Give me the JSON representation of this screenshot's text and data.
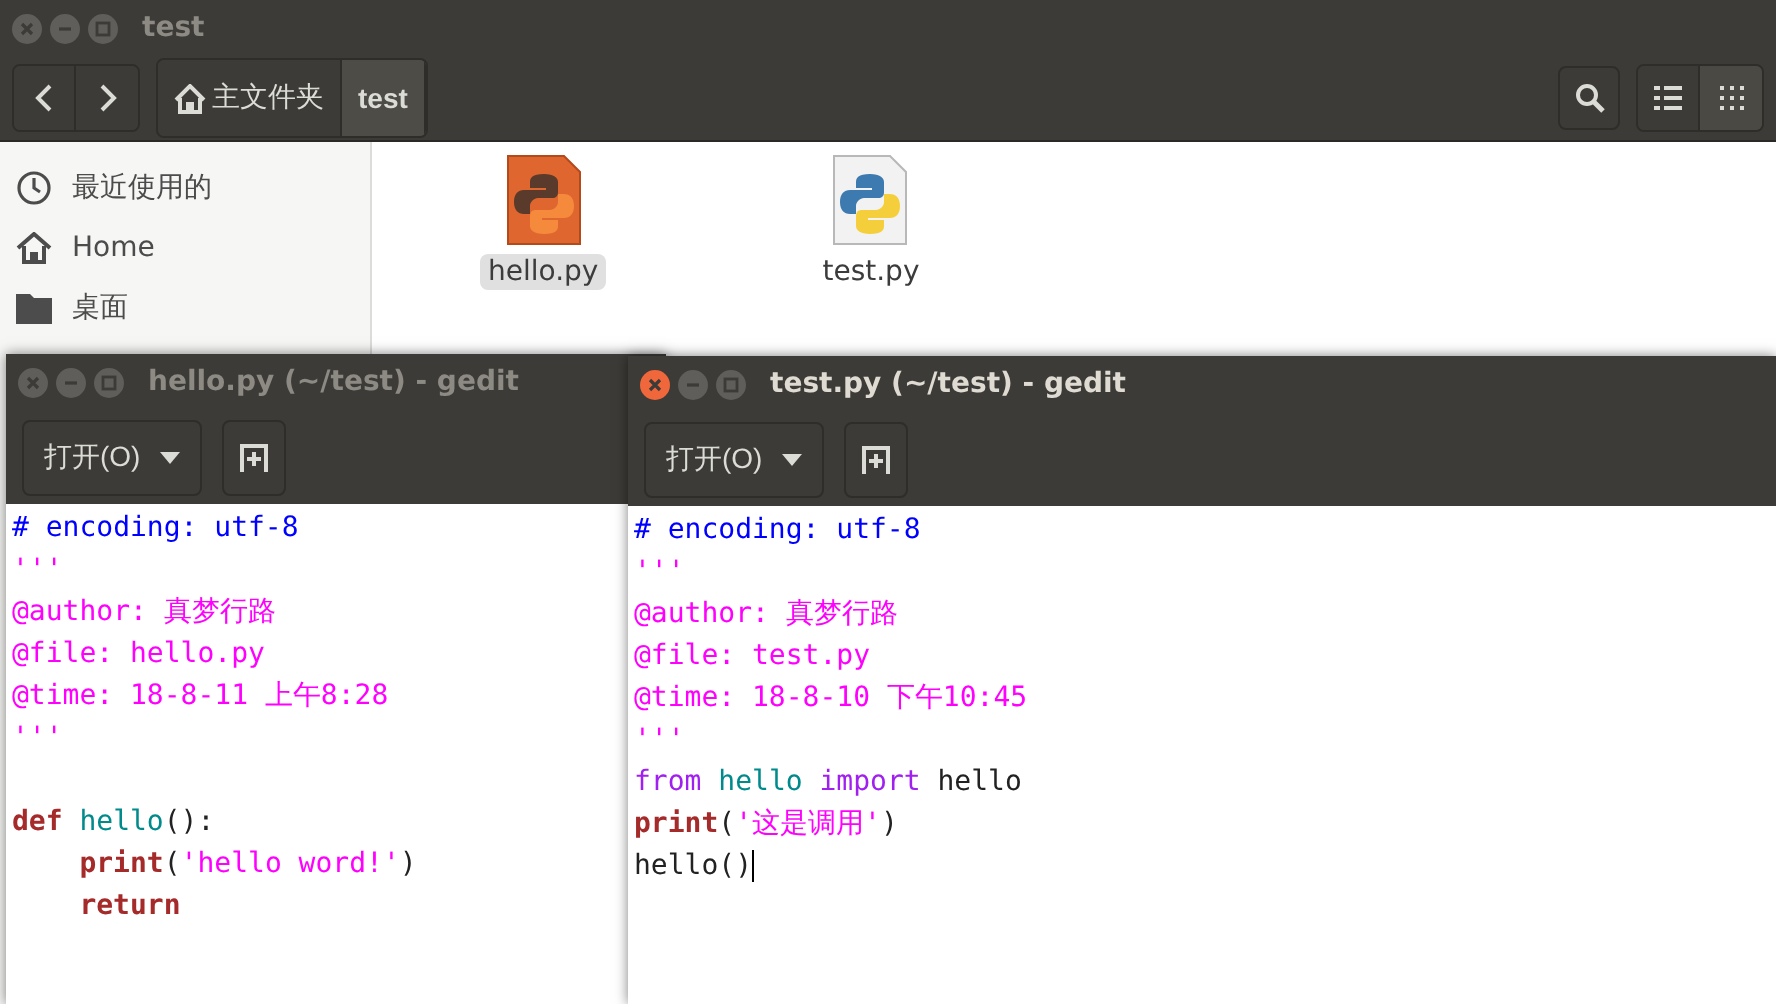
{
  "file_manager": {
    "title": "test",
    "path": [
      {
        "label": "主文件夹",
        "kind": "home",
        "selected": false
      },
      {
        "label": "test",
        "kind": "folder",
        "selected": true
      }
    ],
    "view_modes": [
      {
        "kind": "list",
        "selected": false
      },
      {
        "kind": "grid",
        "selected": true
      }
    ],
    "sidebar": [
      {
        "label": "最近使用的",
        "kind": "clock"
      },
      {
        "label": "Home",
        "kind": "home"
      },
      {
        "label": "桌面",
        "kind": "folder"
      }
    ],
    "files": [
      {
        "name": "hello.py",
        "kind": "orange",
        "selected": true
      },
      {
        "name": "test.py",
        "kind": "plain",
        "selected": false
      }
    ]
  },
  "editors": [
    {
      "title": "hello.py (~/test) - gedit",
      "active": false,
      "open_button": "打开(O)",
      "lines": [
        {
          "tokens": [
            {
              "kind": "comment",
              "text": "# encoding: utf-8"
            }
          ]
        },
        {
          "tokens": [
            {
              "kind": "string",
              "text": "'''"
            }
          ]
        },
        {
          "tokens": [
            {
              "kind": "string",
              "text": "@author: 真梦行路"
            }
          ]
        },
        {
          "tokens": [
            {
              "kind": "string",
              "text": "@file: hello.py"
            }
          ]
        },
        {
          "tokens": [
            {
              "kind": "string",
              "text": "@time: 18-8-11 上午8:28"
            }
          ]
        },
        {
          "tokens": [
            {
              "kind": "string",
              "text": "'''"
            }
          ]
        },
        {
          "gap_before": true,
          "tokens": [
            {
              "kind": "keyword",
              "text": "def "
            },
            {
              "kind": "name",
              "text": "hello"
            },
            {
              "kind": "plain",
              "text": "():"
            }
          ]
        },
        {
          "indented": true,
          "tokens": [
            {
              "kind": "keyword",
              "text": "print"
            },
            {
              "kind": "plain",
              "text": "("
            },
            {
              "kind": "string",
              "text": "'hello word!'"
            },
            {
              "kind": "plain",
              "text": ")"
            }
          ]
        },
        {
          "indented": true,
          "tokens": [
            {
              "kind": "keyword",
              "text": "return"
            }
          ]
        }
      ]
    },
    {
      "title": "test.py (~/test) - gedit",
      "active": true,
      "open_button": "打开(O)",
      "lines": [
        {
          "tokens": [
            {
              "kind": "comment",
              "text": "# encoding: utf-8"
            }
          ]
        },
        {
          "tokens": [
            {
              "kind": "string",
              "text": "'''"
            }
          ]
        },
        {
          "tokens": [
            {
              "kind": "string",
              "text": "@author: 真梦行路"
            }
          ]
        },
        {
          "tokens": [
            {
              "kind": "string",
              "text": "@file: test.py"
            }
          ]
        },
        {
          "tokens": [
            {
              "kind": "string",
              "text": "@time: 18-8-10 下午10:45"
            }
          ]
        },
        {
          "tokens": [
            {
              "kind": "string",
              "text": "'''"
            }
          ]
        },
        {
          "tokens": [
            {
              "kind": "import",
              "text": "from "
            },
            {
              "kind": "name",
              "text": "hello "
            },
            {
              "kind": "import",
              "text": "import "
            },
            {
              "kind": "plain",
              "text": "hello"
            }
          ]
        },
        {
          "tokens": [
            {
              "kind": "keyword",
              "text": "print"
            },
            {
              "kind": "plain",
              "text": "("
            },
            {
              "kind": "string",
              "text": "'这是调用'"
            },
            {
              "kind": "plain",
              "text": ")"
            }
          ]
        },
        {
          "cursor": true,
          "tokens": [
            {
              "kind": "plain",
              "text": "hello()"
            }
          ]
        }
      ]
    }
  ]
}
